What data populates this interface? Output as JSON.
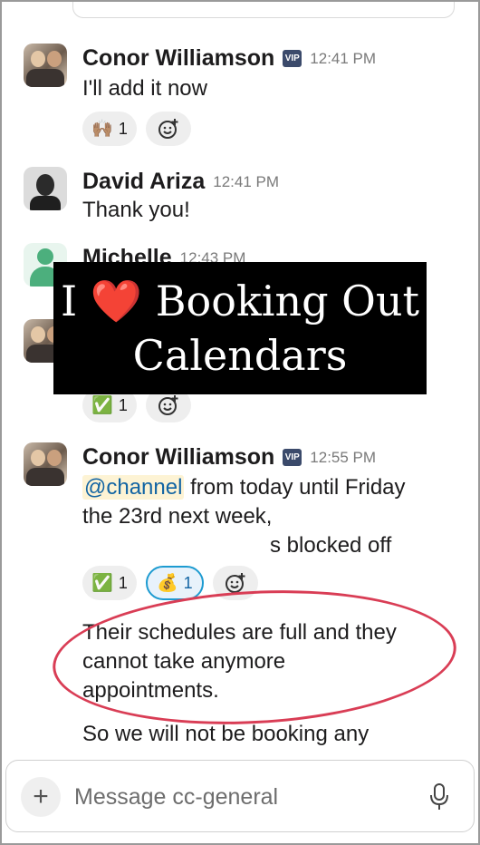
{
  "messages": [
    {
      "author": "Conor Williamson",
      "badge": "VIP",
      "time": "12:41 PM",
      "lines": [
        "I'll add it now"
      ],
      "reactions": [
        {
          "emoji": "🙌🏽",
          "count": "1"
        }
      ]
    },
    {
      "author": "David Ariza",
      "time": "12:41 PM",
      "lines": [
        "Thank you!"
      ]
    },
    {
      "author": "Michelle",
      "time": "12:43 PM",
      "reactions": [
        {
          "emoji": "✅",
          "count": "1"
        }
      ]
    },
    {
      "author": "Conor Williamson",
      "badge": "VIP",
      "time": "12:55 PM",
      "mention": "@channel",
      "lines": [
        " from today until Friday",
        "the 23rd next week,",
        "s blocked off"
      ],
      "reactions": [
        {
          "emoji": "✅",
          "count": "1"
        },
        {
          "emoji": "💰",
          "count": "1"
        }
      ],
      "continuation": [
        "Their schedules are full and they",
        "cannot take anymore",
        "appointments.",
        "So we will not be booking any"
      ]
    }
  ],
  "overlay": {
    "line1_left": "I",
    "heart": "❤️",
    "line1_right": "Booking Out",
    "line2": "Calendars"
  },
  "composer": {
    "placeholder": "Message cc-general"
  },
  "icons": {
    "add": "+",
    "add_reaction": "add-reaction-icon",
    "mic": "microphone-icon"
  },
  "colors": {
    "overlay_bg": "#000000",
    "heart": "#e0242f",
    "annotation_circle": "#d93d55",
    "mention_text": "#1264a3",
    "vip_badge": "#3b4a6b"
  }
}
